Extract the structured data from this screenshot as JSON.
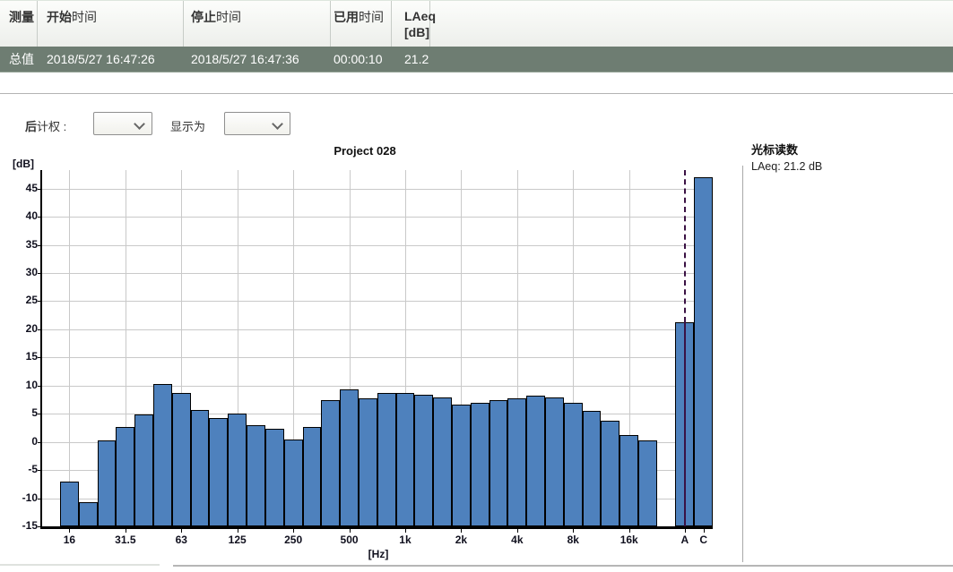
{
  "colors": {
    "row_bg": "#6e7d72",
    "bar_fill": "#4e81bd",
    "bar_border": "#000000",
    "grid": "#c9c9c9",
    "cursor": "#3a1144"
  },
  "table": {
    "headers": {
      "measurement": "测量",
      "start_bold": "开始",
      "start_rest": "时间",
      "stop_bold": "停止",
      "stop_rest": "时间",
      "elapsed_bold": "已用",
      "elapsed_rest": "时间",
      "laeq_line1": "LAeq",
      "laeq_line2": "[dB]"
    },
    "row": {
      "measurement": "总值",
      "start": "2018/5/27 16:47:26",
      "stop": "2018/5/27 16:47:36",
      "elapsed": "00:00:10",
      "laeq": "21.2"
    }
  },
  "controls": {
    "post_weighting_bold": "后",
    "post_weighting_rest": "计权 :",
    "post_weighting_value": "",
    "display_as_label": "显示为",
    "display_as_value": ""
  },
  "cursor_panel": {
    "title": "光标读数",
    "reading": "LAeq: 21.2 dB"
  },
  "chart_data": {
    "type": "bar",
    "title": "Project 028",
    "ylabel": "[dB]",
    "xlabel": "[Hz]",
    "ylim": [
      -15,
      48.3
    ],
    "grid": true,
    "yticks": [
      45,
      40,
      35,
      30,
      25,
      20,
      15,
      10,
      5,
      0,
      -5,
      -10,
      -15
    ],
    "categories": [
      "16",
      "20",
      "25",
      "31.5",
      "40",
      "50",
      "63",
      "80",
      "100",
      "125",
      "160",
      "200",
      "250",
      "315",
      "400",
      "500",
      "630",
      "800",
      "1k",
      "1.25k",
      "1.6k",
      "2k",
      "2.5k",
      "3.15k",
      "4k",
      "5k",
      "6.3k",
      "8k",
      "10k",
      "12.5k",
      "16k",
      "20k"
    ],
    "values": [
      -7.0,
      -10.7,
      0.2,
      2.6,
      4.9,
      10.3,
      8.7,
      5.6,
      4.2,
      5.1,
      2.9,
      2.4,
      0.4,
      2.6,
      7.4,
      9.3,
      7.8,
      8.7,
      8.7,
      8.4,
      7.9,
      6.6,
      7.0,
      7.4,
      7.7,
      8.2,
      7.9,
      7.0,
      5.5,
      3.7,
      1.2,
      0.3
    ],
    "xtick_labels": [
      "16",
      "31.5",
      "63",
      "125",
      "250",
      "500",
      "1k",
      "2k",
      "4k",
      "8k",
      "16k"
    ],
    "xtick_band_indices": [
      0,
      3,
      6,
      9,
      12,
      15,
      18,
      21,
      24,
      27,
      30
    ],
    "extra_bars": [
      {
        "label": "A",
        "value": 21.2
      },
      {
        "label": "C",
        "value": 47.1
      }
    ],
    "cursor": {
      "at": "A",
      "value": 21.2
    }
  }
}
